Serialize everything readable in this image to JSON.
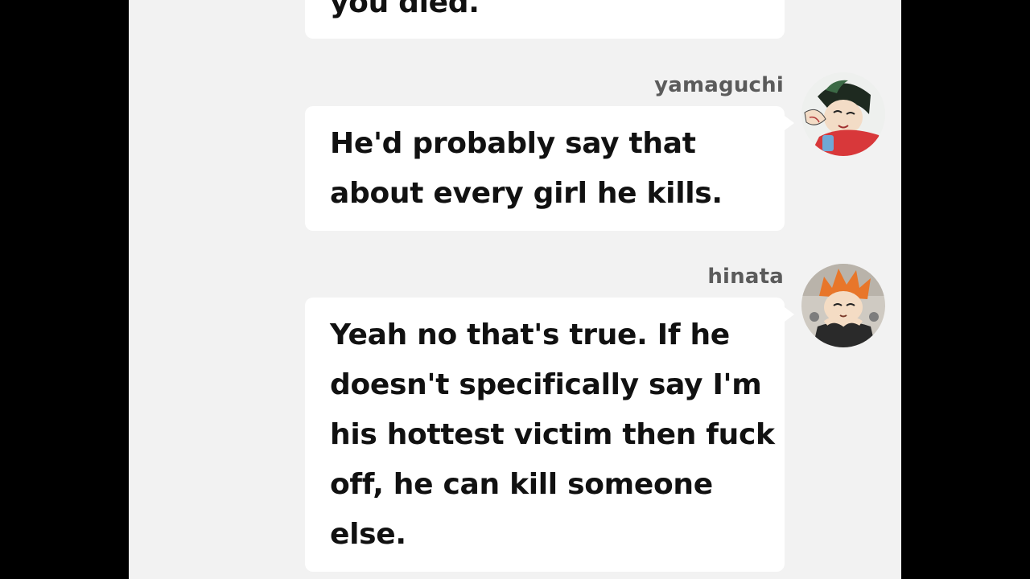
{
  "chat": {
    "messages": [
      {
        "sender": "",
        "lines": [
          "you died."
        ]
      },
      {
        "sender": "yamaguchi",
        "lines": [
          "He'd probably say that",
          "about every girl he kills."
        ]
      },
      {
        "sender": "hinata",
        "lines": [
          "Yeah no that's true. If he",
          "doesn't specifically say I'm",
          "his hottest victim then fuck",
          "off, he can kill someone",
          "else."
        ]
      }
    ]
  },
  "colors": {
    "background": "#f2f2f2",
    "bubble": "#ffffff",
    "text": "#111111",
    "sender": "#5b5b5b",
    "side_bars": "#000000"
  }
}
